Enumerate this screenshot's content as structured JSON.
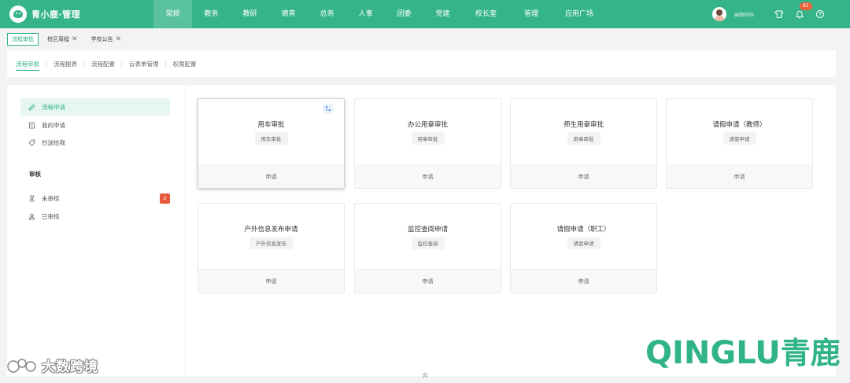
{
  "app": {
    "logo_text": "青小鹿·管理"
  },
  "nav": {
    "items": [
      {
        "label": "常规",
        "active": true
      },
      {
        "label": "教务"
      },
      {
        "label": "教研"
      },
      {
        "label": "德育"
      },
      {
        "label": "总务"
      },
      {
        "label": "人事"
      },
      {
        "label": "团委"
      },
      {
        "label": "党建"
      },
      {
        "label": "校长室"
      },
      {
        "label": "管理"
      },
      {
        "label": "应用广场"
      }
    ]
  },
  "user": {
    "name": "admin",
    "notification_count": "81"
  },
  "tabs": [
    {
      "label": "流程审批",
      "active": true
    },
    {
      "label": "校区周程",
      "closable": true
    },
    {
      "label": "学校公告",
      "closable": true
    }
  ],
  "subtabs": [
    {
      "label": "流程审批",
      "active": true
    },
    {
      "label": "流程报表"
    },
    {
      "label": "流程配置"
    },
    {
      "label": "云表单管理"
    },
    {
      "label": "权限配置"
    }
  ],
  "sidebar": {
    "items": [
      {
        "label": "流程申请",
        "icon": "edit-icon",
        "active": true
      },
      {
        "label": "我的申请",
        "icon": "document-icon"
      },
      {
        "label": "抄送给我",
        "icon": "tag-icon"
      }
    ],
    "section_title": "审核",
    "review_items": [
      {
        "label": "未审核",
        "icon": "hourglass-icon",
        "badge": "2"
      },
      {
        "label": "已审核",
        "icon": "stamp-icon"
      }
    ]
  },
  "cards": [
    {
      "title": "用车审批",
      "tag": "用车审批",
      "action": "申请",
      "selected": true
    },
    {
      "title": "办公用章审批",
      "tag": "用章审批",
      "action": "申请"
    },
    {
      "title": "师生用章审批",
      "tag": "用章审批",
      "action": "申请"
    },
    {
      "title": "请假申请（教师）",
      "tag": "请假申请",
      "action": "申请"
    },
    {
      "title": "户外信息发布申请",
      "tag": "户外信息发布",
      "action": "申请"
    },
    {
      "title": "监控查阅申请",
      "tag": "监控查阅",
      "action": "申请"
    },
    {
      "title": "请假申请（职工）",
      "tag": "请假申请",
      "action": "申请"
    }
  ],
  "watermarks": {
    "left": "大数跨境",
    "right_en": "QINGLU",
    "right_cn": "青鹿"
  },
  "colors": {
    "brand": "#35b489",
    "badge": "#e85a3f"
  }
}
